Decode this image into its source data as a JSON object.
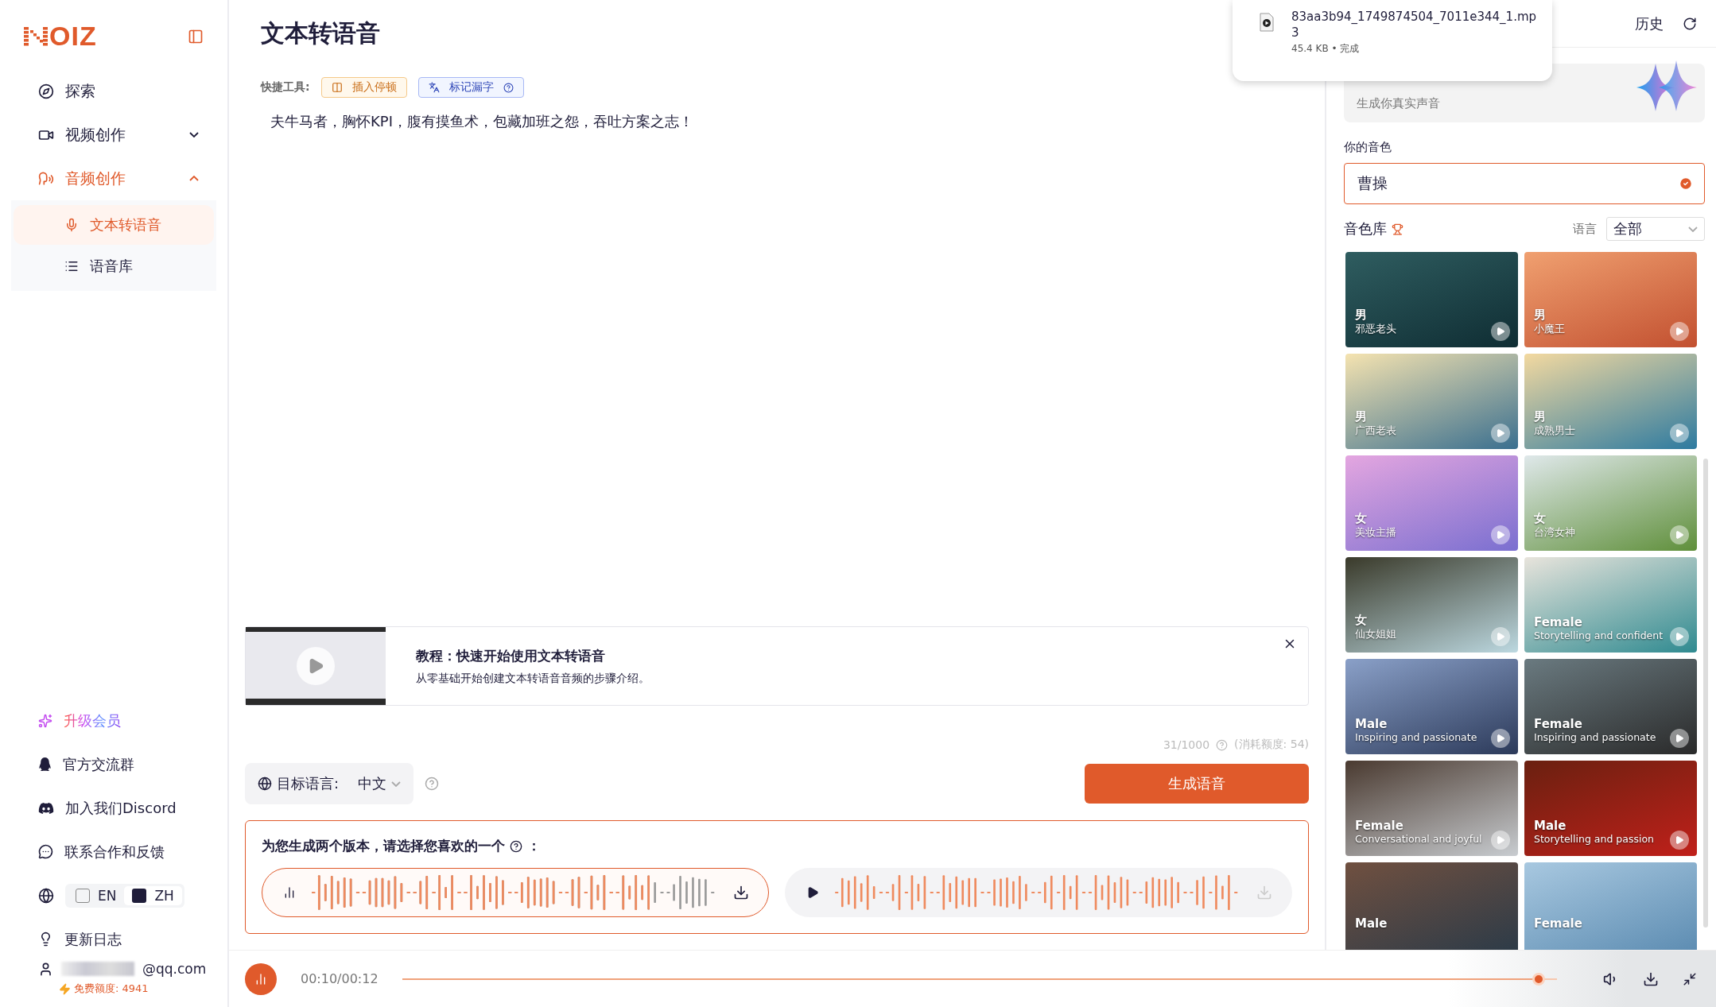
{
  "sidebar": {
    "logo": "OIZ",
    "nav": [
      {
        "kind": "link",
        "label": "探索"
      },
      {
        "kind": "group",
        "label": "视频创作",
        "expanded": false,
        "active": false
      },
      {
        "kind": "group",
        "label": "音频创作",
        "expanded": true,
        "active": true,
        "children": [
          {
            "label": "文本转语音",
            "selected": true
          },
          {
            "label": "语音库",
            "selected": false
          }
        ]
      }
    ],
    "footer": [
      {
        "kind": "upgrade",
        "label": "升级会员"
      },
      {
        "kind": "qq",
        "label": "官方交流群"
      },
      {
        "kind": "discord",
        "label": "加入我们Discord"
      },
      {
        "kind": "feedback",
        "label": "联系合作和反馈"
      },
      {
        "kind": "language",
        "options": [
          {
            "label": "EN",
            "selected": false
          },
          {
            "label": "ZH",
            "selected": true
          }
        ]
      },
      {
        "kind": "changelog",
        "label": "更新日志"
      }
    ],
    "account": {
      "email": "@qq.com",
      "quota": "免费额度: 4941"
    }
  },
  "main": {
    "title": "文本转语音",
    "quick_tools_label": "快捷工具:",
    "quick_tools": [
      {
        "kind": "pause",
        "label": "插入停顿"
      },
      {
        "kind": "mark",
        "label": "标记漏字"
      }
    ],
    "text": "夫牛马者，胸怀KPI，腹有摸鱼术，包藏加班之怨，吞吐方案之志！",
    "tutorial": {
      "title": "教程：快速开始使用文本转语音",
      "description": "从零基础开始创建文本转语音音频的步骤介绍。"
    },
    "counter": "31/1000",
    "cost": "(消耗额度: 54)",
    "target_language": {
      "label": "目标语言:",
      "value": "中文"
    },
    "generate_button": "生成语音",
    "versions_title": "为您生成两个版本，请选择您喜欢的一个",
    "versions_suffix": "：",
    "versions": [
      {
        "selected": true,
        "level": 0.84
      },
      {
        "selected": false
      }
    ]
  },
  "download": {
    "filename": "83aa3b94_1749874504_7011e344_1.mp3",
    "status": "45.4 KB • 完成"
  },
  "right_panel": {
    "history": "历史",
    "clone_card": {
      "subtitle": "生成你真实声音"
    },
    "your_voice_label": "你的音色",
    "your_voice": "曹操",
    "library_label": "音色库",
    "language_label": "语言",
    "language_value": "全部",
    "voices": [
      {
        "gender": "男",
        "desc": "邪恶老头"
      },
      {
        "gender": "男",
        "desc": "小魔王"
      },
      {
        "gender": "男",
        "desc": "广西老表"
      },
      {
        "gender": "男",
        "desc": "成熟男士"
      },
      {
        "gender": "女",
        "desc": "美妆主播"
      },
      {
        "gender": "女",
        "desc": "台湾女神"
      },
      {
        "gender": "女",
        "desc": "仙女姐姐"
      },
      {
        "gender": "Female",
        "desc": "Storytelling and confident"
      },
      {
        "gender": "Male",
        "desc": "Inspiring and passionate"
      },
      {
        "gender": "Female",
        "desc": "Inspiring and passionate"
      },
      {
        "gender": "Female",
        "desc": "Conversational and joyful"
      },
      {
        "gender": "Male",
        "desc": "Storytelling and passion"
      },
      {
        "gender": "Male"
      },
      {
        "gender": "Female"
      }
    ]
  },
  "player": {
    "time": "00:10/00:12",
    "level": 0.99
  }
}
